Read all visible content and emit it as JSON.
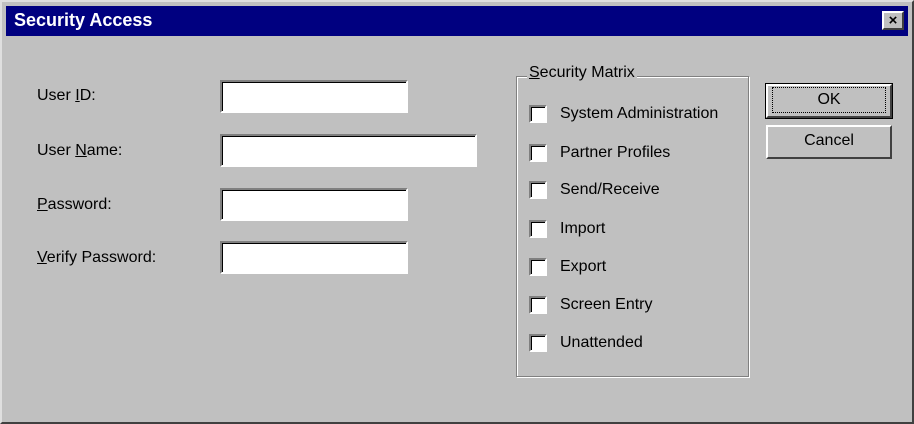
{
  "window": {
    "title": "Security Access",
    "close_glyph": "×"
  },
  "fields": {
    "user_id": {
      "label_pre": "User ",
      "label_key": "I",
      "label_post": "D:",
      "value": ""
    },
    "user_name": {
      "label_pre": "User ",
      "label_key": "N",
      "label_post": "ame:",
      "value": ""
    },
    "password": {
      "label_pre": "",
      "label_key": "P",
      "label_post": "assword:",
      "value": ""
    },
    "verify_password": {
      "label_pre": "",
      "label_key": "V",
      "label_post": "erify Password:",
      "value": ""
    }
  },
  "security_matrix": {
    "title_key": "S",
    "title_rest": "ecurity Matrix",
    "items": [
      {
        "label": "System Administration",
        "checked": false
      },
      {
        "label": "Partner Profiles",
        "checked": false
      },
      {
        "label": "Send/Receive",
        "checked": false
      },
      {
        "label": "Import",
        "checked": false
      },
      {
        "label": "Export",
        "checked": false
      },
      {
        "label": "Screen Entry",
        "checked": false
      },
      {
        "label": "Unattended",
        "checked": false
      }
    ]
  },
  "buttons": {
    "ok": "OK",
    "cancel": "Cancel"
  }
}
